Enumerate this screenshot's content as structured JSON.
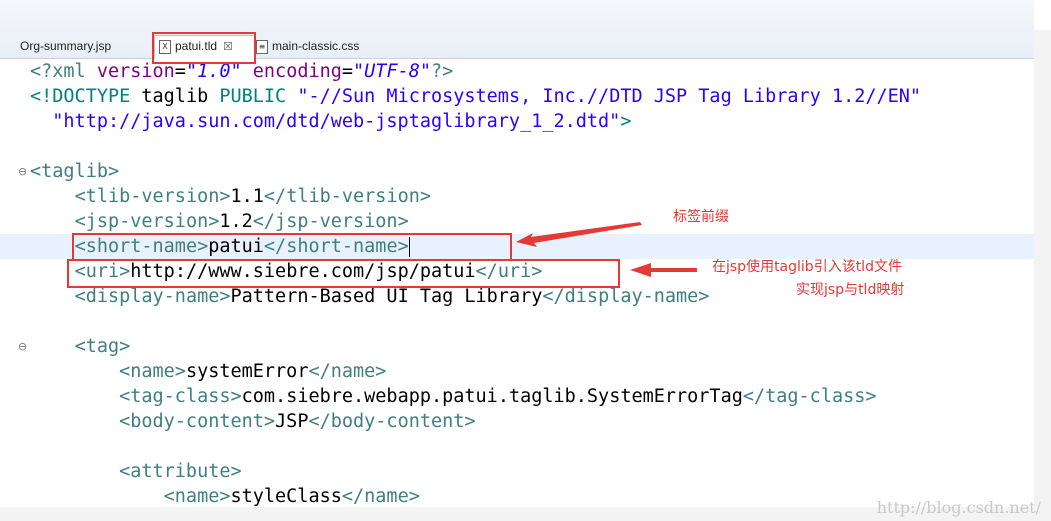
{
  "tabs": [
    {
      "label": "Org-summary.jsp",
      "active": false
    },
    {
      "label": "patui.tld",
      "active": true,
      "close": "☒"
    },
    {
      "label": "main-classic.css",
      "active": false
    }
  ],
  "lines": [
    [
      [
        "t",
        "<?xml "
      ],
      [
        "a",
        "version"
      ],
      [
        "k",
        "="
      ],
      [
        "v",
        "\"1.0\""
      ],
      [
        "k",
        " "
      ],
      [
        "a",
        "encoding"
      ],
      [
        "k",
        "="
      ],
      [
        "v",
        "\"UTF-8\""
      ],
      [
        "t",
        "?>"
      ]
    ],
    [
      [
        "d",
        "<!DOCTYPE "
      ],
      [
        "k",
        "taglib "
      ],
      [
        "d",
        "PUBLIC "
      ],
      [
        "s",
        "\"-//Sun Microsystems, Inc.//DTD JSP Tag Library 1.2//EN\""
      ]
    ],
    [
      [
        "k",
        "  "
      ],
      [
        "s",
        "\"http://java.sun.com/dtd/web-jsptaglibrary_1_2.dtd\""
      ],
      [
        "d",
        ">"
      ]
    ],
    [],
    [
      [
        "t",
        "<taglib>"
      ]
    ],
    [
      [
        "k",
        "    "
      ],
      [
        "t",
        "<tlib-version>"
      ],
      [
        "k",
        "1.1"
      ],
      [
        "t",
        "</tlib-version>"
      ]
    ],
    [
      [
        "k",
        "    "
      ],
      [
        "t",
        "<jsp-version>"
      ],
      [
        "k",
        "1.2"
      ],
      [
        "t",
        "</jsp-version>"
      ]
    ],
    [
      [
        "k",
        "    "
      ],
      [
        "t",
        "<short-name>"
      ],
      [
        "k",
        "patui"
      ],
      [
        "t",
        "</short-name>"
      ]
    ],
    [
      [
        "k",
        "    "
      ],
      [
        "t",
        "<uri>"
      ],
      [
        "k",
        "http://www.siebre.com/jsp/patui"
      ],
      [
        "t",
        "</uri>"
      ]
    ],
    [
      [
        "k",
        "    "
      ],
      [
        "t",
        "<display-name>"
      ],
      [
        "k",
        "Pattern-Based UI Tag Library"
      ],
      [
        "t",
        "</display-name>"
      ]
    ],
    [],
    [
      [
        "k",
        "    "
      ],
      [
        "t",
        "<tag>"
      ]
    ],
    [
      [
        "k",
        "        "
      ],
      [
        "t",
        "<name>"
      ],
      [
        "k",
        "systemError"
      ],
      [
        "t",
        "</name>"
      ]
    ],
    [
      [
        "k",
        "        "
      ],
      [
        "t",
        "<tag-class>"
      ],
      [
        "k",
        "com.siebre.webapp.patui.taglib.SystemErrorTag"
      ],
      [
        "t",
        "</tag-class>"
      ]
    ],
    [
      [
        "k",
        "        "
      ],
      [
        "t",
        "<body-content>"
      ],
      [
        "k",
        "JSP"
      ],
      [
        "t",
        "</body-content>"
      ]
    ],
    [],
    [
      [
        "k",
        "        "
      ],
      [
        "t",
        "<attribute>"
      ]
    ],
    [
      [
        "k",
        "            "
      ],
      [
        "t",
        "<name>"
      ],
      [
        "k",
        "styleClass"
      ],
      [
        "t",
        "</name>"
      ]
    ]
  ],
  "annotations": {
    "prefix_note": "标签前缀",
    "uri_note_line1": "在jsp使用taglib引入该tld文件",
    "uri_note_line2": "实现jsp与tld映射"
  },
  "watermark": "http://blog.csdn.net/",
  "colors": {
    "annotation": "#e53935",
    "tag": "#3f7f7f",
    "attribute": "#7f007f",
    "string": "#2a00ff"
  }
}
